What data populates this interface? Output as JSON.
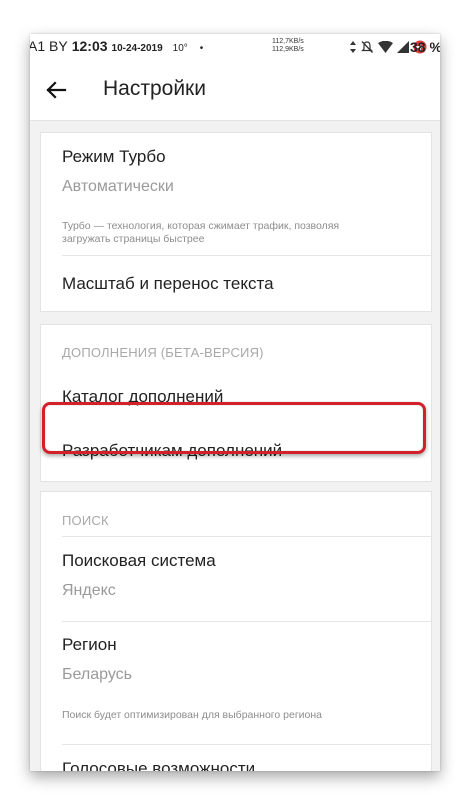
{
  "status_bar": {
    "carrier": "A1 BY",
    "time": "12:03",
    "date": "10-24-2019",
    "temp": "10°",
    "dot": "•",
    "speed_up": "112,7KB/s",
    "speed_down": "112,9KB/s",
    "battery": "38 %"
  },
  "app_bar": {
    "back_icon": "arrow-left-icon",
    "title": "Настройки"
  },
  "turbo_card": {
    "turbo_title": "Режим Турбо",
    "turbo_value": "Автоматически",
    "turbo_hint": "Турбо — технология, которая сжимает трафик, позволяя загружать страницы быстрее",
    "scale_title": "Масштаб и перенос текста"
  },
  "addons_card": {
    "header": "ДОПОЛНЕНИЯ (БЕТА-ВЕРСИЯ)",
    "catalog": "Каталог дополнений",
    "developers": "Разработчикам дополнений"
  },
  "search_card": {
    "header": "ПОИСК",
    "engine_title": "Поисковая система",
    "engine_value": "Яндекс",
    "region_title": "Регион",
    "region_value": "Беларусь",
    "region_hint": "Поиск будет оптимизирован для выбранного региона",
    "voice_title": "Голосовые возможности"
  },
  "colors": {
    "highlight": "#d3212b"
  }
}
